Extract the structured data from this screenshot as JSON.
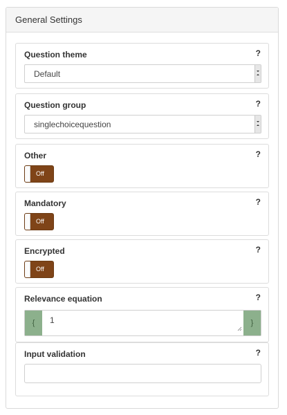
{
  "panel": {
    "title": "General Settings"
  },
  "fields": {
    "question_theme": {
      "label": "Question theme",
      "help": "?",
      "value": "Default"
    },
    "question_group": {
      "label": "Question group",
      "help": "?",
      "value": "singlechoicequestion"
    },
    "other": {
      "label": "Other",
      "help": "?",
      "toggle": "Off"
    },
    "mandatory": {
      "label": "Mandatory",
      "help": "?",
      "toggle": "Off"
    },
    "encrypted": {
      "label": "Encrypted",
      "help": "?",
      "toggle": "Off"
    },
    "relevance": {
      "label": "Relevance equation",
      "help": "?",
      "open_brace": "{",
      "close_brace": "}",
      "value": "1"
    },
    "input_validation": {
      "label": "Input validation",
      "help": "?",
      "value": ""
    }
  },
  "colors": {
    "toggle_off": "#7f4418",
    "brace_bg": "#8cb08c",
    "header_bg": "#f5f5f5"
  }
}
